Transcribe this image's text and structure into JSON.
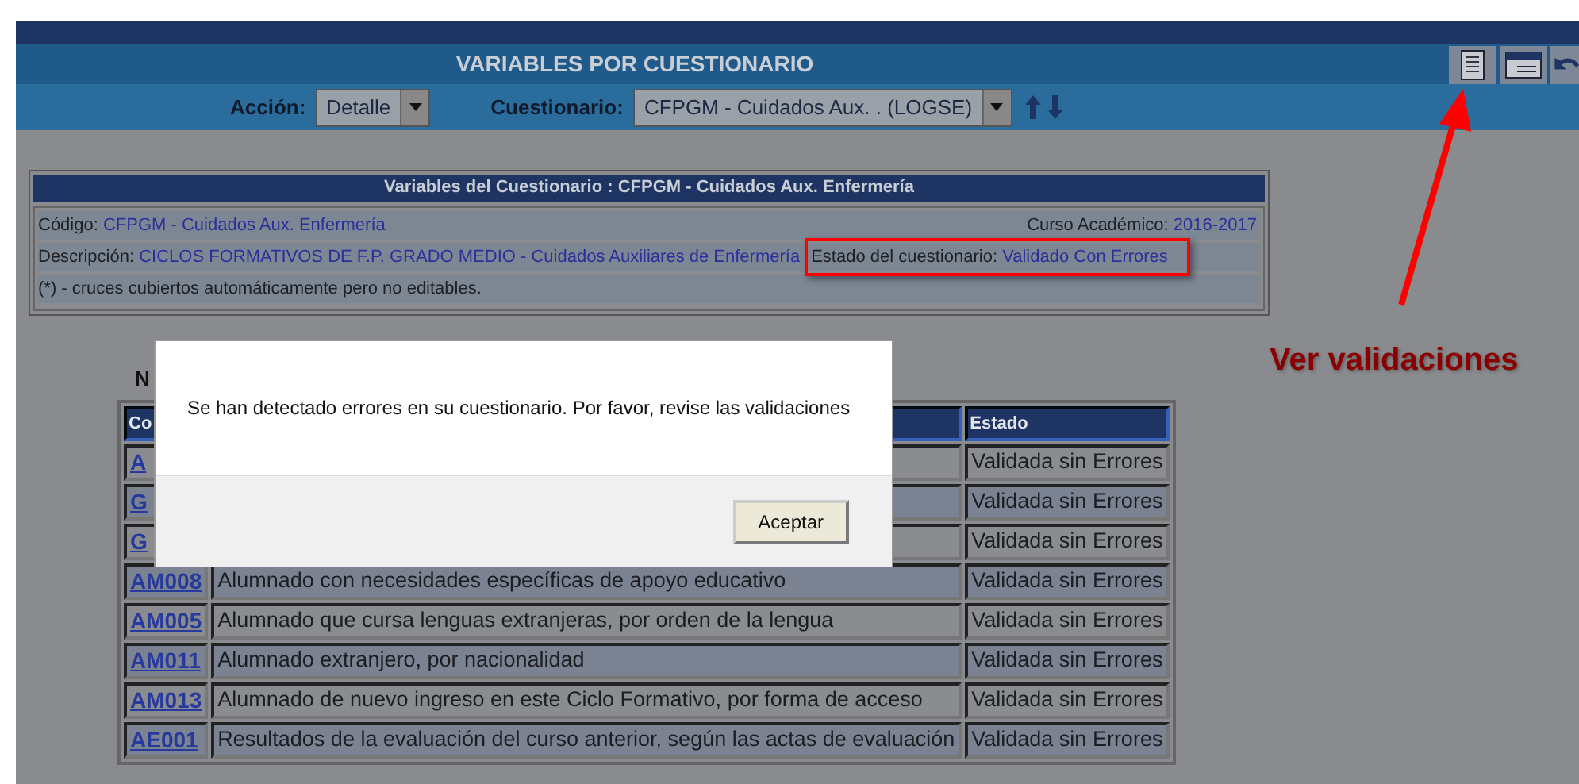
{
  "title": "VARIABLES POR CUESTIONARIO",
  "toolbar_icons": [
    {
      "kind": "document"
    },
    {
      "kind": "window"
    },
    {
      "kind": "undo"
    }
  ],
  "filters": [
    {
      "label": "Acción:",
      "value": "Detalle"
    },
    {
      "label": "Cuestionario:",
      "value": "CFPGM - Cuidados Aux. . (LOGSE)"
    }
  ],
  "info_panel": {
    "title": "Variables del Cuestionario : CFPGM - Cuidados Aux. Enfermería",
    "code": {
      "label": "Código:",
      "value": "CFPGM - Cuidados Aux. Enfermería"
    },
    "year": {
      "label": "Curso Académico:",
      "value": "2016-2017"
    },
    "description": {
      "label": "Descripción:",
      "value": "CICLOS FORMATIVOS DE F.P. GRADO MEDIO - Cuidados Auxiliares de Enfermería"
    },
    "state": {
      "label": "Estado del cuestionario:",
      "value": "Validado Con Errores",
      "highlighted": true
    },
    "note": "(*) - cruces cubiertos automáticamente pero no editables."
  },
  "section_heading": "N",
  "table": {
    "columns": [
      {
        "kind": "code",
        "label": "Co"
      },
      {
        "kind": "description"
      },
      {
        "kind": "status",
        "label": "Estado"
      }
    ],
    "rows": [
      {
        "code": "A",
        "status": "Validada sin Errores"
      },
      {
        "code": "G",
        "status": "Validada sin Errores"
      },
      {
        "code": "G",
        "status": "Validada sin Errores"
      },
      {
        "code": "AM008",
        "description": "Alumnado con necesidades específicas de apoyo educativo",
        "status": "Validada sin Errores"
      },
      {
        "code": "AM005",
        "description": "Alumnado que cursa lenguas extranjeras, por orden de la lengua",
        "status": "Validada sin Errores"
      },
      {
        "code": "AM011",
        "description": "Alumnado extranjero, por nacionalidad",
        "status": "Validada sin Errores"
      },
      {
        "code": "AM013",
        "description": "Alumnado de nuevo ingreso en este Ciclo Formativo, por forma de acceso",
        "status": "Validada sin Errores"
      },
      {
        "code": "AE001",
        "description": "Resultados de la evaluación del curso anterior, según las actas de evaluación",
        "status": "Validada sin Errores"
      }
    ]
  },
  "dialog": {
    "message": "Se han detectado errores en su cuestionario. Por favor, revise las validaciones",
    "button": "Aceptar"
  },
  "annotation": {
    "label": "Ver validaciones"
  }
}
